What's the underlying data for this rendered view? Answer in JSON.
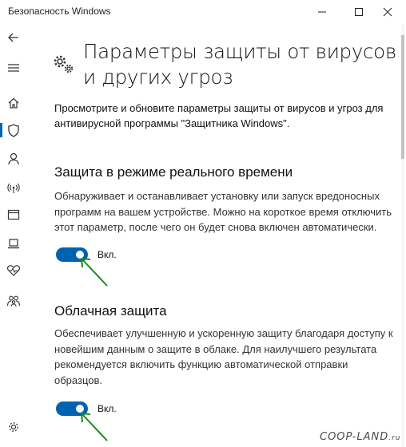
{
  "window": {
    "title": "Безопасность Windows",
    "controls": [
      {
        "name": "minimize-icon"
      },
      {
        "name": "maximize-icon"
      },
      {
        "name": "close-icon"
      }
    ]
  },
  "sidebar": {
    "items": [
      {
        "icon": "back-arrow-icon"
      },
      {
        "icon": "hamburger-menu-icon"
      },
      {
        "icon": "home-icon"
      },
      {
        "icon": "shield-icon",
        "active": true
      },
      {
        "icon": "person-icon"
      },
      {
        "icon": "wifi-antenna-icon"
      },
      {
        "icon": "app-browser-icon"
      },
      {
        "icon": "laptop-icon"
      },
      {
        "icon": "heart-health-icon"
      },
      {
        "icon": "family-icon"
      },
      {
        "icon": "settings-gear-icon"
      }
    ]
  },
  "page": {
    "title": "Параметры защиты от вирусов и других угроз",
    "intro": "Просмотрите и обновите параметры защиты от вирусов и угроз для антивирусной программы \"Защитника Windows\"."
  },
  "sections": [
    {
      "heading": "Защита в режиме реального времени",
      "desc_lines": [
        "Обнаруживает и останавливает установку или запуск вредоносных",
        "программ на вашем устройстве. Можно на короткое время отключить",
        "этот параметр, после чего он будет снова включен автоматически."
      ],
      "toggle_on": true,
      "toggle_label": "Вкл."
    },
    {
      "heading": "Облачная защита",
      "desc_lines": [
        "Обеспечивает улучшенную и ускоренную защиту благодаря доступу к",
        "новейшим данным о защите в облаке. Для наилучшего результата",
        "рекомендуется включить функцию автоматической отправки",
        "образцов."
      ],
      "toggle_on": true,
      "toggle_label": "Вкл."
    }
  ],
  "watermark": {
    "text": "COOP-LAND",
    "tld": ".ru"
  },
  "colors": {
    "accent": "#0063b1",
    "arrow": "#1c8a1c"
  }
}
